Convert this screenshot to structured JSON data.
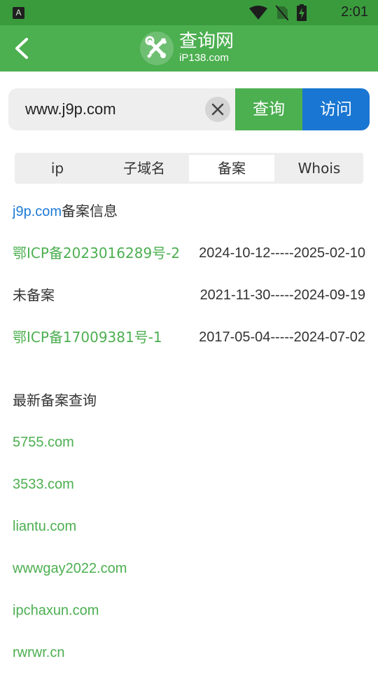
{
  "status_bar": {
    "time": "2:01",
    "notification_icon": "a-badge-icon",
    "icons": [
      "wifi-icon",
      "no-sim-icon",
      "battery-charging-icon"
    ]
  },
  "header": {
    "app_title": "查询网",
    "app_subtitle": "iP138.com",
    "back_icon": "chevron-left-icon",
    "logo_icon": "tools-icon"
  },
  "search": {
    "value": "www.j9p.com",
    "clear_icon": "close-icon",
    "query_label": "查询",
    "visit_label": "访问"
  },
  "tabs": [
    {
      "label": "ip"
    },
    {
      "label": "子域名"
    },
    {
      "label": "备案",
      "active": true
    },
    {
      "label": "Whois"
    }
  ],
  "record_section": {
    "domain": "j9p.com",
    "title_suffix": "备案信息"
  },
  "records": [
    {
      "id": "鄂ICP备2023016289号-2",
      "dates": "2024-10-12-----2025-02-10",
      "status": "filed"
    },
    {
      "id": "未备案",
      "dates": "2021-11-30-----2024-09-19",
      "status": "unfiled"
    },
    {
      "id": "鄂ICP备17009381号-1",
      "dates": "2017-05-04-----2024-07-02",
      "status": "filed"
    }
  ],
  "latest": {
    "title": "最新备案查询",
    "items": [
      "5755.com",
      "3533.com",
      "liantu.com",
      "wwwgay2022.com",
      "ipchaxun.com",
      "rwrwr.cn"
    ]
  },
  "colors": {
    "status_bar": "#3a9b3d",
    "app_bar": "#4caf50",
    "query_button": "#4caf50",
    "visit_button": "#1976d2",
    "link_blue": "#1e7ad6",
    "link_green": "#4caf50"
  }
}
